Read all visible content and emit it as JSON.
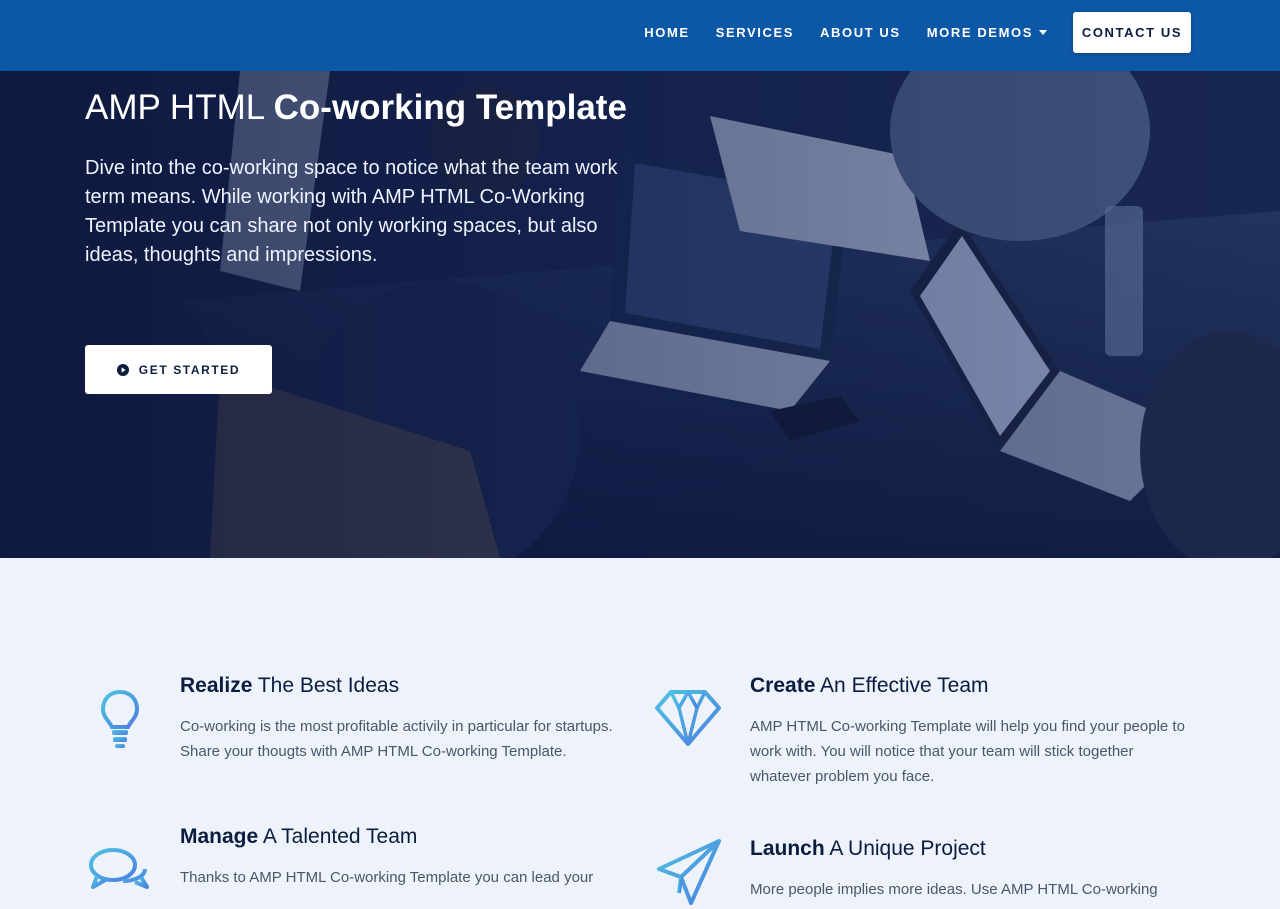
{
  "nav": {
    "items": [
      {
        "label": "HOME"
      },
      {
        "label": "SERVICES"
      },
      {
        "label": "ABOUT US"
      },
      {
        "label": "MORE DEMOS"
      }
    ],
    "contact_label": "CONTACT US"
  },
  "hero": {
    "title_light": "AMP HTML ",
    "title_bold": "Co-working Template",
    "text": "Dive into the co-working space to notice what the team work term means. While working with AMP HTML Co-Working Template you can share not only working spaces, but also ideas, thoughts and impressions.",
    "button_label": "GET STARTED"
  },
  "features": [
    {
      "bold": "Realize",
      "light": " The Best Ideas",
      "icon": "lightbulb-icon",
      "desc": "Co-working is the most profitable activily in particular for startups. Share your thougts with AMP HTML Co-working Template."
    },
    {
      "bold": "Create",
      "light": " An Effective Team",
      "icon": "diamond-icon",
      "desc": "AMP HTML Co-working Template will help you find your people to work with. You will notice that your team will stick together whatever problem you face."
    },
    {
      "bold": "Manage",
      "light": " A Talented Team",
      "icon": "chat-bubbles-icon",
      "desc": "Thanks to AMP HTML Co-working Template you can lead your"
    },
    {
      "bold": "Launch",
      "light": " A Unique Project",
      "icon": "paper-plane-icon",
      "desc": "More people implies more ideas. Use AMP HTML Co-working"
    }
  ],
  "colors": {
    "nav_bg": "#0d58a6",
    "features_bg": "#eef2fb",
    "icon_gradient_start": "#4fc3e0",
    "icon_gradient_end": "#4a7fe0"
  }
}
